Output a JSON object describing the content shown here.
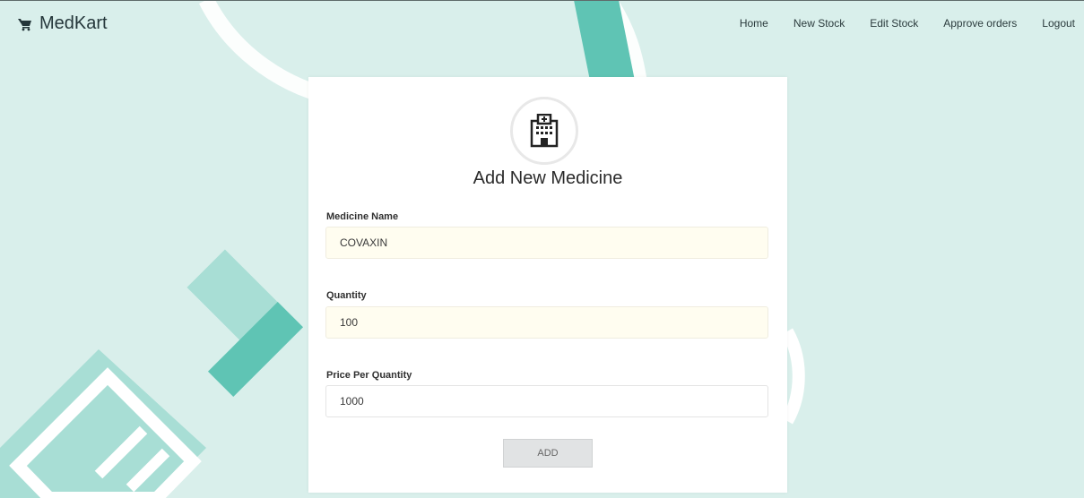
{
  "brand": {
    "name": "MedKart",
    "icon": "cart-icon"
  },
  "nav": {
    "items": [
      {
        "label": "Home"
      },
      {
        "label": "New Stock"
      },
      {
        "label": "Edit Stock"
      },
      {
        "label": "Approve orders"
      },
      {
        "label": "Logout"
      }
    ]
  },
  "form": {
    "icon": "hospital-icon",
    "title": "Add New Medicine",
    "fields": [
      {
        "label": "Medicine Name",
        "value": "COVAXIN"
      },
      {
        "label": "Quantity",
        "value": "100"
      },
      {
        "label": "Price Per Quantity",
        "value": "1000"
      }
    ],
    "submit_label": "ADD"
  },
  "colors": {
    "background": "#d9efeb",
    "accent_teal": "#5fc4b4",
    "light_teal": "#a8ded5",
    "autofill_bg": "#fffdf0"
  }
}
